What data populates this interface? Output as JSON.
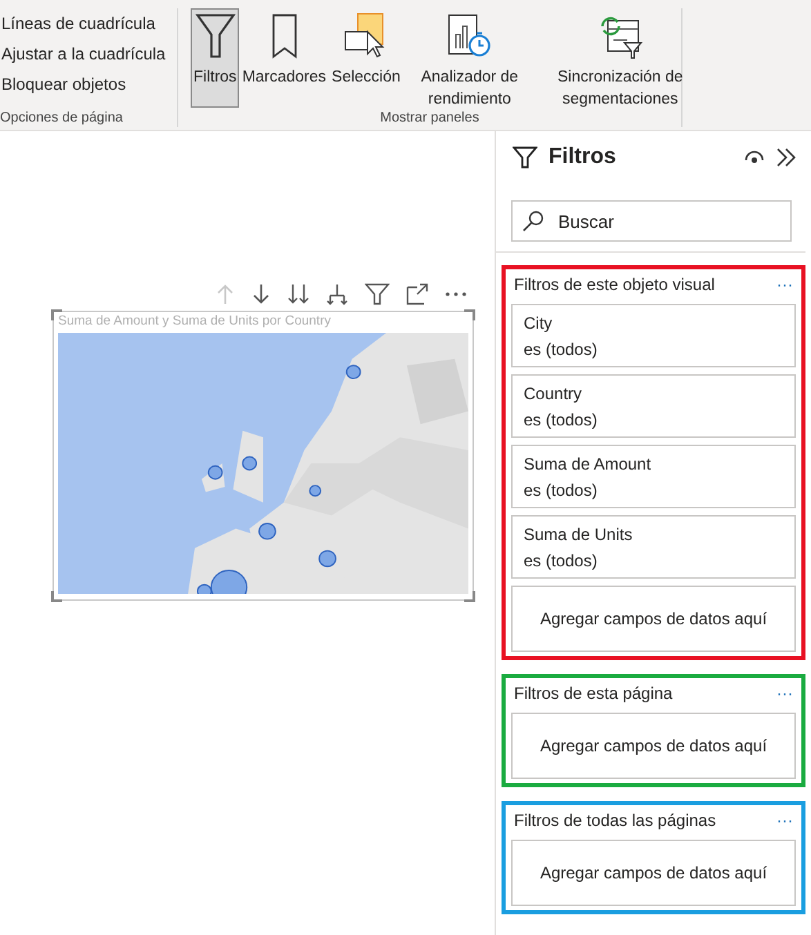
{
  "ribbon": {
    "groups": [
      {
        "kind": "options",
        "label": "Opciones de página",
        "items": [
          "Líneas de cuadrícula",
          "Ajustar a la cuadrícula",
          "Bloquear objetos"
        ]
      },
      {
        "kind": "panes",
        "label": "Mostrar paneles",
        "buttons": [
          {
            "kind": "funnel",
            "label": "Filtros",
            "selected": true
          },
          {
            "kind": "bookmark",
            "label": "Marcadores",
            "selected": false
          },
          {
            "kind": "selection",
            "label": "Selección",
            "selected": false
          },
          {
            "kind": "performance",
            "label": "Analizador de rendimiento",
            "selected": false
          },
          {
            "kind": "sync",
            "label": "Sincronización de segmentaciones",
            "selected": false
          }
        ]
      }
    ]
  },
  "visual": {
    "title": "Suma de Amount y Suma de Units por Country"
  },
  "filters_pane": {
    "title": "Filtros",
    "search": {
      "placeholder": "Buscar"
    },
    "sections": [
      {
        "title": "Filtros de este objeto visual",
        "more": "···",
        "color": "#e81123",
        "cards": [
          {
            "field": "City",
            "value": "es (todos)"
          },
          {
            "field": "Country",
            "value": "es (todos)"
          },
          {
            "field": "Suma de Amount",
            "value": "es (todos)"
          },
          {
            "field": "Suma de Units",
            "value": "es (todos)"
          }
        ],
        "drop": "Agregar campos de datos aquí"
      },
      {
        "title": "Filtros de esta página",
        "more": "···",
        "color": "#1aab40",
        "drop": "Agregar campos de datos aquí"
      },
      {
        "title": "Filtros de todas las páginas",
        "more": "···",
        "color": "#1a9ee0",
        "drop": "Agregar campos de datos aquí"
      }
    ]
  }
}
